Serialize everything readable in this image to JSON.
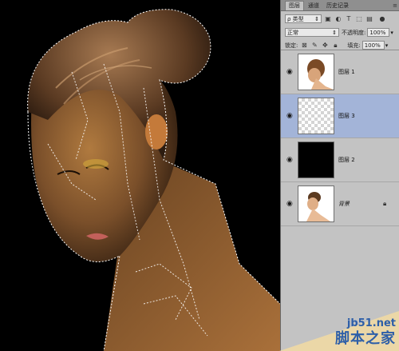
{
  "panel": {
    "tabs": [
      "图层",
      "通道",
      "历史记录"
    ],
    "filter_kind": "ρ 类型",
    "blend_mode": "正常",
    "opacity_label": "不透明度:",
    "opacity_value": "100%",
    "lock_label": "锁定:",
    "fill_label": "填充:",
    "fill_value": "100%"
  },
  "layers": [
    {
      "name": "图层 1",
      "thumb": "portrait",
      "selected": false,
      "visible": true
    },
    {
      "name": "图层 3",
      "thumb": "transparent",
      "selected": true,
      "visible": true
    },
    {
      "name": "图层 2",
      "thumb": "black",
      "selected": false,
      "visible": true
    },
    {
      "name": "背景",
      "thumb": "portrait",
      "selected": false,
      "visible": true,
      "locked": true
    }
  ],
  "watermark": {
    "url": "jb51.net",
    "site": "脚本之家"
  },
  "colors": {
    "panel_bg": "#c3c3c3",
    "selected_layer": "#a3b4d8",
    "watermark": "#2e5fa8"
  }
}
